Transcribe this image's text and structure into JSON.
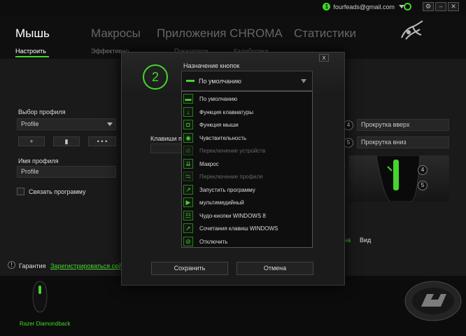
{
  "account": {
    "email": "fourfeads@gmail.com",
    "badge": "1"
  },
  "window_controls": {
    "settings": "⚙",
    "minimize": "–",
    "close": "✕"
  },
  "nav": {
    "mouse": "Мышь",
    "macros": "Макросы",
    "chroma": "Приложения CHROMA",
    "stats": "Статистики"
  },
  "subnav": {
    "customize": "Настроить",
    "effects": "Эффективно",
    "performance": "Показатели",
    "calibration": "Калибровка"
  },
  "profile": {
    "select_label": "Выбор профиля",
    "select_value": "Profile",
    "add": "+",
    "delete": "▮",
    "more": "• • •",
    "name_label": "Имя профиля",
    "name_value": "Profile",
    "link_label": "Связать программу"
  },
  "right_panel": {
    "row1_num": "4",
    "row1_text": "Прокрутка вверх",
    "row2_num": "5",
    "row2_text": "Прокрутка вниз",
    "mouse_num1": "4",
    "mouse_num2": "5",
    "view_tail": "на",
    "view_label": "Вид"
  },
  "footer": {
    "warranty": "Гарантия",
    "register": "Зарегистрироваться сей",
    "device_name": "Razer Diamondback"
  },
  "dialog": {
    "close": "x",
    "button_number": "2",
    "assign_label": "Назначение кнопок",
    "assign_value": "По умолчанию",
    "keys_label": "Клавиши п",
    "save": "Сохранить",
    "cancel": "Отмена",
    "menu": [
      {
        "label": "По умолчанию",
        "icon": "default-icon",
        "glyph": "▬",
        "enabled": true
      },
      {
        "label": "Функция клавиатуры",
        "icon": "keyboard-icon",
        "glyph": "↓",
        "enabled": true
      },
      {
        "label": "Функция мыши",
        "icon": "mouse-icon",
        "glyph": "◘",
        "enabled": true
      },
      {
        "label": "Чувствительность",
        "icon": "sensitivity-icon",
        "glyph": "◉",
        "enabled": true
      },
      {
        "label": "Переключение устройств",
        "icon": "device-switch-icon",
        "glyph": "⊘",
        "enabled": false
      },
      {
        "label": "Макрос",
        "icon": "macro-icon",
        "glyph": "⇊",
        "enabled": true
      },
      {
        "label": "Переключение профиля",
        "icon": "profile-switch-icon",
        "glyph": "⇆",
        "enabled": false
      },
      {
        "label": "Запустить программу",
        "icon": "launch-icon",
        "glyph": "↗",
        "enabled": true
      },
      {
        "label": "мультимедийный",
        "icon": "multimedia-icon",
        "glyph": "▶",
        "enabled": true
      },
      {
        "label": "Чудо-кнопки WINDOWS 8",
        "icon": "charms-icon",
        "glyph": "☷",
        "enabled": true
      },
      {
        "label": "Сочетания клавиш WINDOWS",
        "icon": "shortcut-icon",
        "glyph": "➚",
        "enabled": true
      },
      {
        "label": "Отключить",
        "icon": "disable-icon",
        "glyph": "⊘",
        "enabled": true
      }
    ]
  },
  "colors": {
    "accent": "#44d62c",
    "background": "#1a1a1a"
  }
}
